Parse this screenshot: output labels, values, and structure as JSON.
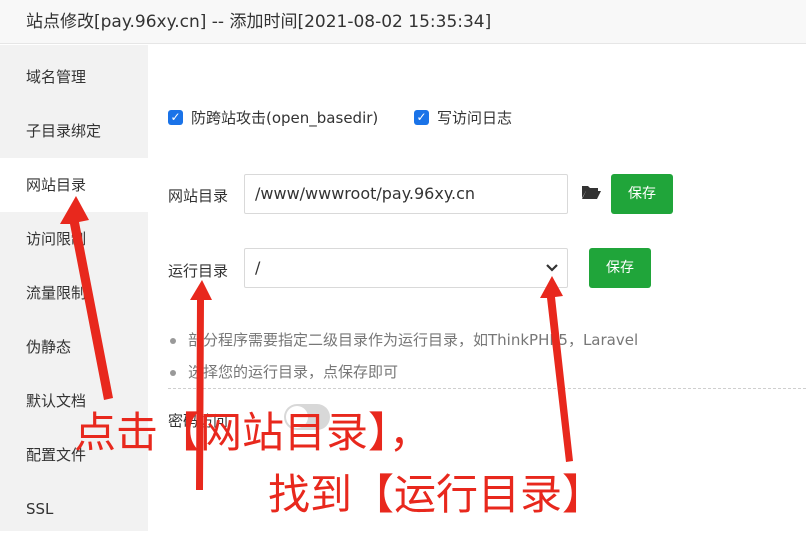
{
  "window": {
    "title": "站点修改[pay.96xy.cn] -- 添加时间[2021-08-02 15:35:34]"
  },
  "sidebar": {
    "items": [
      {
        "label": "域名管理"
      },
      {
        "label": "子目录绑定"
      },
      {
        "label": "网站目录"
      },
      {
        "label": "访问限制"
      },
      {
        "label": "流量限制"
      },
      {
        "label": "伪静态"
      },
      {
        "label": "默认文档"
      },
      {
        "label": "配置文件"
      },
      {
        "label": "SSL"
      }
    ],
    "active_index": 2
  },
  "options": {
    "anti_cross_site": {
      "label": "防跨站攻击(open_basedir)",
      "checked": true
    },
    "access_log": {
      "label": "写访问日志",
      "checked": true
    }
  },
  "site_dir": {
    "label": "网站目录",
    "value": "/www/wwwroot/pay.96xy.cn",
    "folder_icon": "folder-open-icon",
    "save_label": "保存"
  },
  "run_dir": {
    "label": "运行目录",
    "selected": "/",
    "save_label": "保存"
  },
  "tips": [
    "部分程序需要指定二级目录作为运行目录，如ThinkPHP5，Laravel",
    "选择您的运行目录，点保存即可"
  ],
  "password_access": {
    "label": "密码访问",
    "enabled": false
  },
  "annotations": {
    "line1": "点击【网站目录】，",
    "line2": "找到【运行目录】",
    "color": "#e8281d"
  },
  "colors": {
    "save_button": "#20a53a",
    "checkbox": "#1a73e8",
    "sidebar_bg": "#f2f2f2"
  }
}
